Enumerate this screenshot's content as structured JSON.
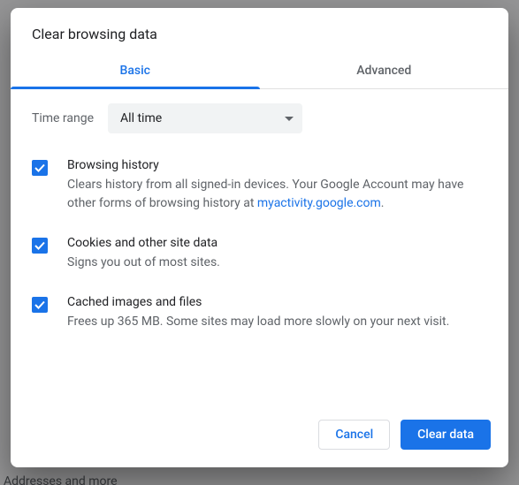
{
  "dialog": {
    "title": "Clear browsing data",
    "tabs": {
      "basic": "Basic",
      "advanced": "Advanced"
    },
    "timerange": {
      "label": "Time range",
      "value": "All time"
    },
    "options": {
      "history": {
        "title": "Browsing history",
        "desc_pre": "Clears history from all signed-in devices. Your Google Account may have other forms of browsing history at ",
        "link": "myactivity.google.com",
        "desc_post": "."
      },
      "cookies": {
        "title": "Cookies and other site data",
        "desc": "Signs you out of most sites."
      },
      "cache": {
        "title": "Cached images and files",
        "desc": "Frees up 365 MB. Some sites may load more slowly on your next visit."
      }
    },
    "buttons": {
      "cancel": "Cancel",
      "clear": "Clear data"
    }
  },
  "background": {
    "addresses": "Addresses and more"
  }
}
